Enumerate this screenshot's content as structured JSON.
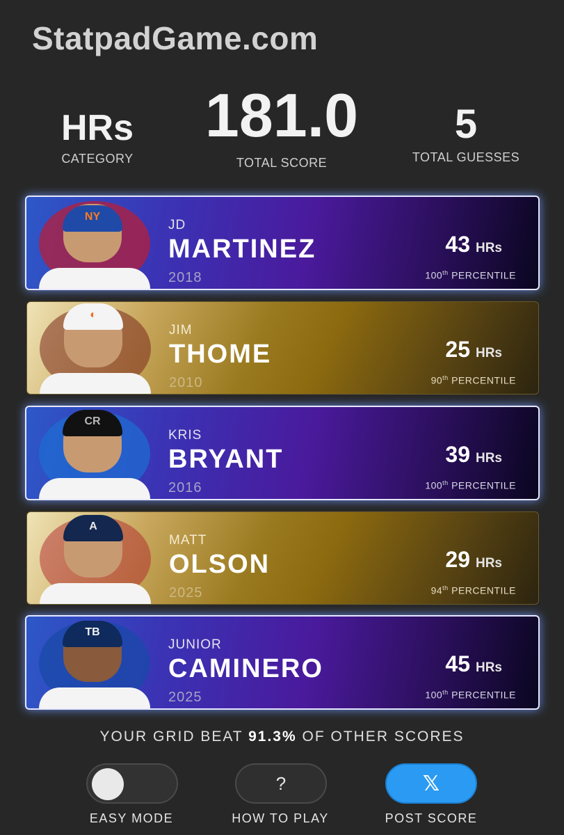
{
  "site_title": "StatpadGame.com",
  "stats": {
    "category": {
      "value": "HRs",
      "label": "CATEGORY"
    },
    "total_score": {
      "value": "181.0",
      "label": "TOTAL SCORE"
    },
    "total_guesses": {
      "value": "5",
      "label": "TOTAL GUESSES"
    }
  },
  "players": [
    {
      "first": "JD",
      "last": "MARTINEZ",
      "year": "2018",
      "value": "43",
      "unit": "HRs",
      "pct_num": "100",
      "pct_suffix": "th",
      "pct_label": "PERCENTILE",
      "style": "purple",
      "cap_logo": "NY"
    },
    {
      "first": "JIM",
      "last": "THOME",
      "year": "2010",
      "value": "25",
      "unit": "HRs",
      "pct_num": "90",
      "pct_suffix": "th",
      "pct_label": "PERCENTILE",
      "style": "gold",
      "cap_logo": "◐"
    },
    {
      "first": "KRIS",
      "last": "BRYANT",
      "year": "2016",
      "value": "39",
      "unit": "HRs",
      "pct_num": "100",
      "pct_suffix": "th",
      "pct_label": "PERCENTILE",
      "style": "purple",
      "cap_logo": "CR"
    },
    {
      "first": "MATT",
      "last": "OLSON",
      "year": "2025",
      "value": "29",
      "unit": "HRs",
      "pct_num": "94",
      "pct_suffix": "th",
      "pct_label": "PERCENTILE",
      "style": "gold",
      "cap_logo": "A"
    },
    {
      "first": "JUNIOR",
      "last": "CAMINERO",
      "year": "2025",
      "value": "45",
      "unit": "HRs",
      "pct_num": "100",
      "pct_suffix": "th",
      "pct_label": "PERCENTILE",
      "style": "purple",
      "cap_logo": "TB"
    }
  ],
  "beat": {
    "prefix": "YOUR GRID BEAT",
    "percent": "91.3%",
    "suffix": "OF OTHER SCORES"
  },
  "buttons": {
    "easy_mode": "EASY MODE",
    "how_to_play": "HOW TO PLAY",
    "how_to_play_icon": "?",
    "post_score": "POST SCORE",
    "post_score_icon": "𝕏"
  },
  "colors": {
    "background": "#272727",
    "purple_accent": "#4a1a9c",
    "gold_accent": "#9a7a1f",
    "post_button": "#2b9af3"
  },
  "icons": [
    "toggle-knob-icon",
    "question-icon",
    "x-logo-icon"
  ]
}
